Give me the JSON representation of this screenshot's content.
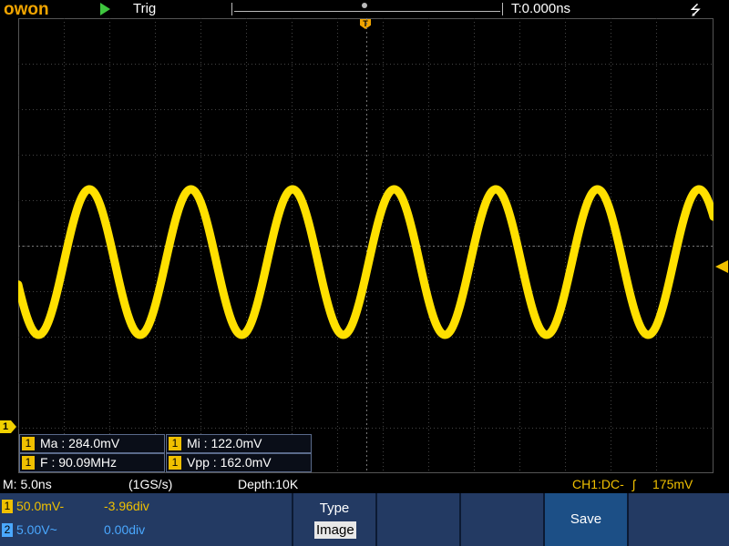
{
  "header": {
    "logo": "owon",
    "trigger_status": "Trig",
    "time_offset": "T:0.000ns",
    "usb_icon": "usb-icon"
  },
  "trigger_marker": "T",
  "channel_marker": "1",
  "waveform": {
    "color": "#ffe000",
    "frequency_label": "90.09MHz"
  },
  "measurements": [
    {
      "ch": "1",
      "text": "Ma : 284.0mV"
    },
    {
      "ch": "1",
      "text": "Mi : 122.0mV"
    },
    {
      "ch": "1",
      "text": "F : 90.09MHz"
    },
    {
      "ch": "1",
      "text": "Vpp : 162.0mV"
    }
  ],
  "status": {
    "timebase": "M: 5.0ns",
    "sample_rate": "(1GS/s)",
    "depth": "Depth:10K",
    "trigger_info": "CH1:DC-",
    "trigger_edge": "ʃ",
    "trigger_level": "175mV"
  },
  "channels": [
    {
      "num": "1",
      "scale": "50.0mV-",
      "offset": "-3.96div",
      "color": "#f0c000"
    },
    {
      "num": "2",
      "scale": "5.00V~",
      "offset": "0.00div",
      "color": "#4aa8ff"
    }
  ],
  "menu": {
    "type_label": "Type",
    "type_value": "Image",
    "save_label": "Save"
  }
}
